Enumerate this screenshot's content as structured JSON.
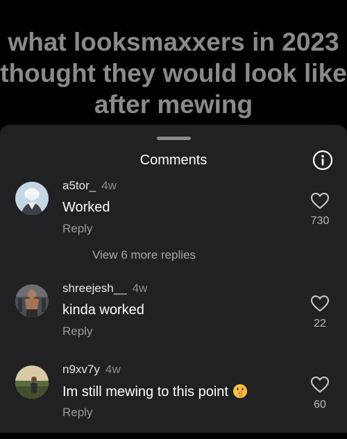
{
  "video": {
    "caption": "what looksmaxxers in 2023 thought they would look like after mewing"
  },
  "sheet": {
    "title": "Comments",
    "info_icon": "info-icon"
  },
  "comments": [
    {
      "username": "a5tor_",
      "time": "4w",
      "text": "Worked",
      "reply_label": "Reply",
      "likes": "730",
      "view_replies": "View 6 more replies"
    },
    {
      "username": "shreejesh__",
      "time": "4w",
      "text": "kinda worked",
      "reply_label": "Reply",
      "likes": "22"
    },
    {
      "username": "n9xv7y",
      "time": "4w",
      "text": "Im still mewing to this point",
      "reply_label": "Reply",
      "likes": "60",
      "emoji": "shushing-face-emoji"
    }
  ],
  "colors": {
    "sheet_bg": "#212124",
    "caption": "#8a8a8a",
    "secondary_text": "#9a9aa0"
  }
}
